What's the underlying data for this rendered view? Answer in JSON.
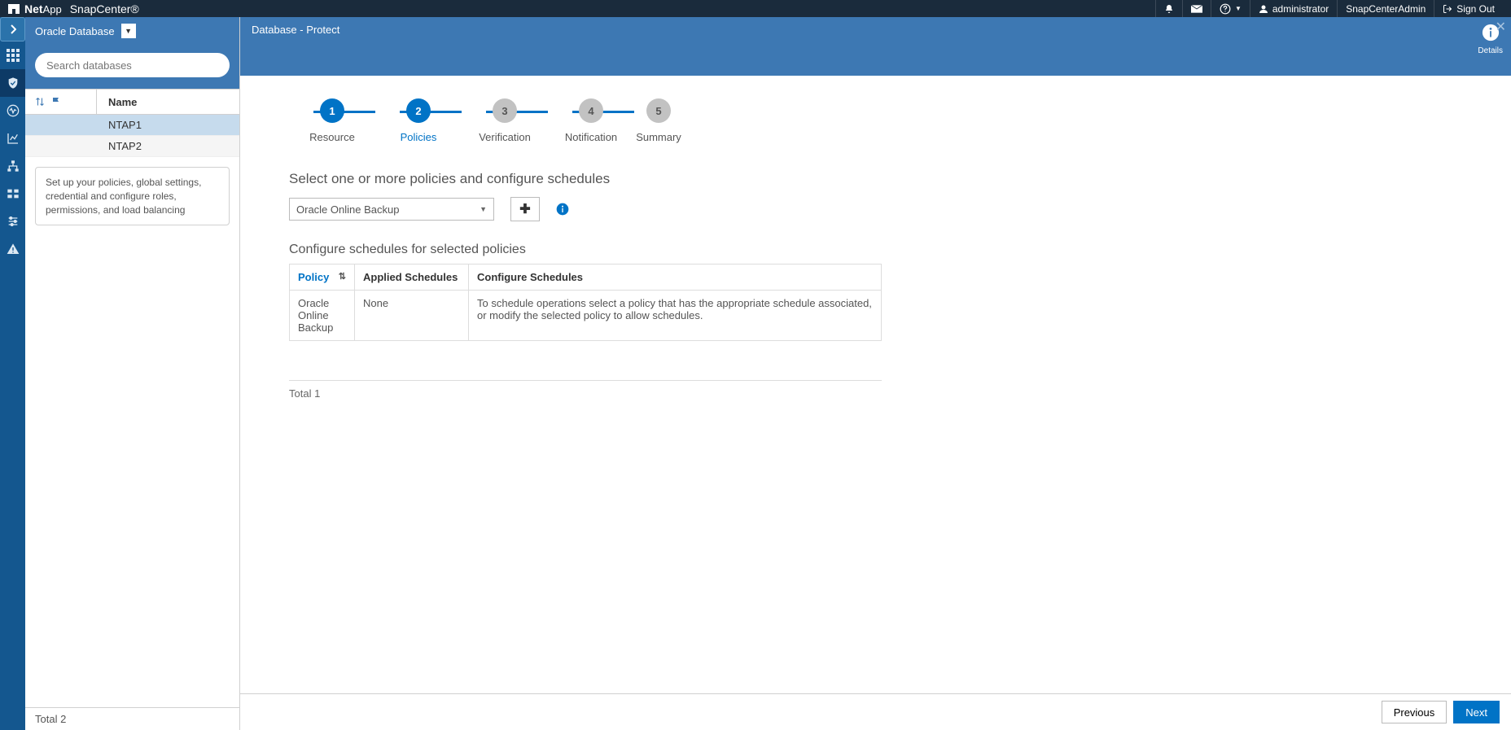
{
  "topbar": {
    "brand_prefix": "Net",
    "brand_suffix": "App",
    "product": "SnapCenter®",
    "user_label": "administrator",
    "role_label": "SnapCenterAdmin",
    "signout_label": "Sign Out"
  },
  "leftpanel": {
    "dropdown_label": "Oracle Database",
    "search_placeholder": "Search databases",
    "name_header": "Name",
    "rows": [
      {
        "name": "NTAP1"
      },
      {
        "name": "NTAP2"
      }
    ],
    "tooltip": "Set up your policies, global settings, credential and configure roles, permissions, and load balancing",
    "footer_total": "Total 2"
  },
  "main": {
    "breadcrumb": "Database - Protect",
    "details_label": "Details",
    "steps": [
      {
        "num": "1",
        "label": "Resource"
      },
      {
        "num": "2",
        "label": "Policies"
      },
      {
        "num": "3",
        "label": "Verification"
      },
      {
        "num": "4",
        "label": "Notification"
      },
      {
        "num": "5",
        "label": "Summary"
      }
    ],
    "policy_section_title": "Select one or more policies and configure schedules",
    "policy_select_value": "Oracle Online Backup",
    "cfg_title": "Configure schedules for selected policies",
    "sched_headers": {
      "policy": "Policy",
      "applied": "Applied Schedules",
      "configure": "Configure Schedules"
    },
    "sched_rows": [
      {
        "policy": "Oracle Online Backup",
        "applied": "None",
        "configure": "To schedule operations select a policy that has the appropriate schedule associated, or modify the selected policy to allow schedules."
      }
    ],
    "total_line": "Total 1",
    "prev_label": "Previous",
    "next_label": "Next"
  }
}
